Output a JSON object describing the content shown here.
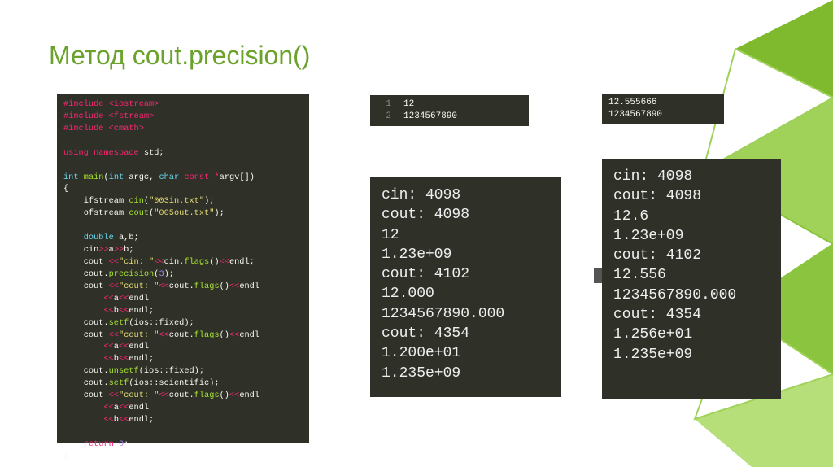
{
  "title": "Метод cout.precision()",
  "code": {
    "lines": [
      [
        [
          "kw-pink",
          "#include"
        ],
        [
          "plain",
          " "
        ],
        [
          "kw-pink",
          "<iostream>"
        ]
      ],
      [
        [
          "kw-pink",
          "#include"
        ],
        [
          "plain",
          " "
        ],
        [
          "kw-pink",
          "<fstream>"
        ]
      ],
      [
        [
          "kw-pink",
          "#include"
        ],
        [
          "plain",
          " "
        ],
        [
          "kw-pink",
          "<cmath>"
        ]
      ],
      [
        [
          "plain",
          ""
        ]
      ],
      [
        [
          "kw-pink",
          "using"
        ],
        [
          "plain",
          " "
        ],
        [
          "kw-pink",
          "namespace"
        ],
        [
          "plain",
          " std;"
        ]
      ],
      [
        [
          "plain",
          ""
        ]
      ],
      [
        [
          "kw-blue",
          "int"
        ],
        [
          "plain",
          " "
        ],
        [
          "kw-green",
          "main"
        ],
        [
          "plain",
          "("
        ],
        [
          "kw-blue",
          "int"
        ],
        [
          "plain",
          " argc, "
        ],
        [
          "kw-blue",
          "char"
        ],
        [
          "plain",
          " "
        ],
        [
          "kw-pink",
          "const"
        ],
        [
          "plain",
          " "
        ],
        [
          "kw-pink",
          "*"
        ],
        [
          "plain",
          "argv[])"
        ]
      ],
      [
        [
          "plain",
          "{"
        ]
      ],
      [
        [
          "plain",
          "    ifstream "
        ],
        [
          "kw-green",
          "cin"
        ],
        [
          "plain",
          "("
        ],
        [
          "kw-yellow",
          "\"003in.txt\""
        ],
        [
          "plain",
          ");"
        ]
      ],
      [
        [
          "plain",
          "    ofstream "
        ],
        [
          "kw-green",
          "cout"
        ],
        [
          "plain",
          "("
        ],
        [
          "kw-yellow",
          "\"005out.txt\""
        ],
        [
          "plain",
          ");"
        ]
      ],
      [
        [
          "plain",
          ""
        ]
      ],
      [
        [
          "plain",
          "    "
        ],
        [
          "kw-blue",
          "double"
        ],
        [
          "plain",
          " a,b;"
        ]
      ],
      [
        [
          "plain",
          "    cin"
        ],
        [
          "kw-pink",
          ">>"
        ],
        [
          "plain",
          "a"
        ],
        [
          "kw-pink",
          ">>"
        ],
        [
          "plain",
          "b;"
        ]
      ],
      [
        [
          "plain",
          "    cout "
        ],
        [
          "kw-pink",
          "<<"
        ],
        [
          "kw-yellow",
          "\"cin: \""
        ],
        [
          "kw-pink",
          "<<"
        ],
        [
          "plain",
          "cin."
        ],
        [
          "kw-green",
          "flags"
        ],
        [
          "plain",
          "()"
        ],
        [
          "kw-pink",
          "<<"
        ],
        [
          "plain",
          "endl;"
        ]
      ],
      [
        [
          "plain",
          "    cout."
        ],
        [
          "kw-green",
          "precision"
        ],
        [
          "plain",
          "("
        ],
        [
          "kw-purple",
          "3"
        ],
        [
          "plain",
          ");"
        ]
      ],
      [
        [
          "plain",
          "    cout "
        ],
        [
          "kw-pink",
          "<<"
        ],
        [
          "kw-yellow",
          "\"cout: \""
        ],
        [
          "kw-pink",
          "<<"
        ],
        [
          "plain",
          "cout."
        ],
        [
          "kw-green",
          "flags"
        ],
        [
          "plain",
          "()"
        ],
        [
          "kw-pink",
          "<<"
        ],
        [
          "plain",
          "endl"
        ]
      ],
      [
        [
          "plain",
          "        "
        ],
        [
          "kw-pink",
          "<<"
        ],
        [
          "plain",
          "a"
        ],
        [
          "kw-pink",
          "<<"
        ],
        [
          "plain",
          "endl"
        ]
      ],
      [
        [
          "plain",
          "        "
        ],
        [
          "kw-pink",
          "<<"
        ],
        [
          "plain",
          "b"
        ],
        [
          "kw-pink",
          "<<"
        ],
        [
          "plain",
          "endl;"
        ]
      ],
      [
        [
          "plain",
          "    cout."
        ],
        [
          "kw-green",
          "setf"
        ],
        [
          "plain",
          "(ios::fixed);"
        ]
      ],
      [
        [
          "plain",
          "    cout "
        ],
        [
          "kw-pink",
          "<<"
        ],
        [
          "kw-yellow",
          "\"cout: \""
        ],
        [
          "kw-pink",
          "<<"
        ],
        [
          "plain",
          "cout."
        ],
        [
          "kw-green",
          "flags"
        ],
        [
          "plain",
          "()"
        ],
        [
          "kw-pink",
          "<<"
        ],
        [
          "plain",
          "endl"
        ]
      ],
      [
        [
          "plain",
          "        "
        ],
        [
          "kw-pink",
          "<<"
        ],
        [
          "plain",
          "a"
        ],
        [
          "kw-pink",
          "<<"
        ],
        [
          "plain",
          "endl"
        ]
      ],
      [
        [
          "plain",
          "        "
        ],
        [
          "kw-pink",
          "<<"
        ],
        [
          "plain",
          "b"
        ],
        [
          "kw-pink",
          "<<"
        ],
        [
          "plain",
          "endl;"
        ]
      ],
      [
        [
          "plain",
          "    cout."
        ],
        [
          "kw-green",
          "unsetf"
        ],
        [
          "plain",
          "(ios::fixed);"
        ]
      ],
      [
        [
          "plain",
          "    cout."
        ],
        [
          "kw-green",
          "setf"
        ],
        [
          "plain",
          "(ios::scientific);"
        ]
      ],
      [
        [
          "plain",
          "    cout "
        ],
        [
          "kw-pink",
          "<<"
        ],
        [
          "kw-yellow",
          "\"cout: \""
        ],
        [
          "kw-pink",
          "<<"
        ],
        [
          "plain",
          "cout."
        ],
        [
          "kw-green",
          "flags"
        ],
        [
          "plain",
          "()"
        ],
        [
          "kw-pink",
          "<<"
        ],
        [
          "plain",
          "endl"
        ]
      ],
      [
        [
          "plain",
          "        "
        ],
        [
          "kw-pink",
          "<<"
        ],
        [
          "plain",
          "a"
        ],
        [
          "kw-pink",
          "<<"
        ],
        [
          "plain",
          "endl"
        ]
      ],
      [
        [
          "plain",
          "        "
        ],
        [
          "kw-pink",
          "<<"
        ],
        [
          "plain",
          "b"
        ],
        [
          "kw-pink",
          "<<"
        ],
        [
          "plain",
          "endl;"
        ]
      ],
      [
        [
          "plain",
          ""
        ]
      ],
      [
        [
          "plain",
          "    "
        ],
        [
          "kw-pink",
          "return"
        ],
        [
          "plain",
          " "
        ],
        [
          "kw-purple",
          "0"
        ],
        [
          "plain",
          ";"
        ]
      ],
      [
        [
          "plain",
          "}"
        ]
      ]
    ]
  },
  "input1": {
    "line1_num": "1",
    "line1_val": "12",
    "line2_num": "2",
    "line2_val": "1234567890"
  },
  "input2": {
    "line1": "12.555666",
    "line2": "1234567890"
  },
  "output1": [
    "cin: 4098",
    "cout: 4098",
    "12",
    "1.23e+09",
    "cout: 4102",
    "12.000",
    "1234567890.000",
    "cout: 4354",
    "1.200e+01",
    "1.235e+09"
  ],
  "output2": [
    "cin: 4098",
    "cout: 4098",
    "12.6",
    "1.23e+09",
    "cout: 4102",
    "12.556",
    "1234567890.000",
    "cout: 4354",
    "1.256e+01",
    "1.235e+09"
  ]
}
